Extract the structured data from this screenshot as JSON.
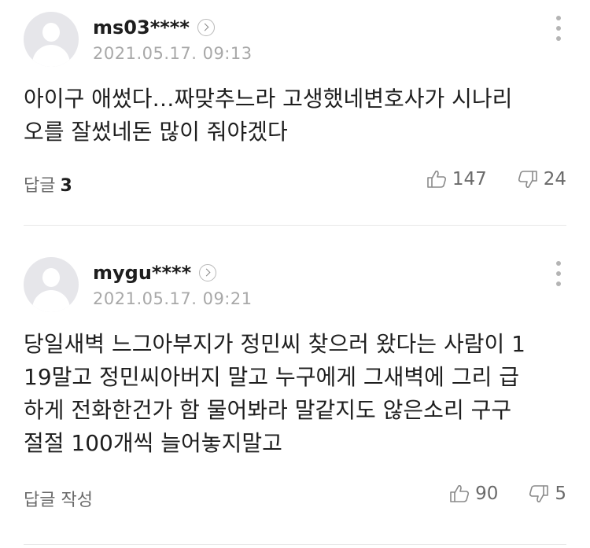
{
  "comments": [
    {
      "username": "ms03****",
      "date": "2021.05.17. 09:13",
      "text": "아이구 애썼다…짜맞추느라 고생했네변호사가 시나리\n오를 잘썼네돈 많이 줘야겠다",
      "reply_label": "답글",
      "reply_count": "3",
      "likes": "147",
      "dislikes": "24"
    },
    {
      "username": "mygu****",
      "date": "2021.05.17. 09:21",
      "text": "당일새벽 느그아부지가 정민씨 찾으러 왔다는 사람이 1\n19말고 정민씨아버지 말고 누구에게 그새벽에 그리 급\n하게 전화한건가 함 물어봐라 말같지도 않은소리 구구\n절절 100개씩 늘어놓지말고",
      "reply_label": "답글 작성",
      "likes": "90",
      "dislikes": "5"
    }
  ],
  "icons": {
    "like": "thumbs-up-icon",
    "dislike": "thumbs-down-icon",
    "more": "more-vertical-icon",
    "profile": "chevron-right-icon"
  }
}
